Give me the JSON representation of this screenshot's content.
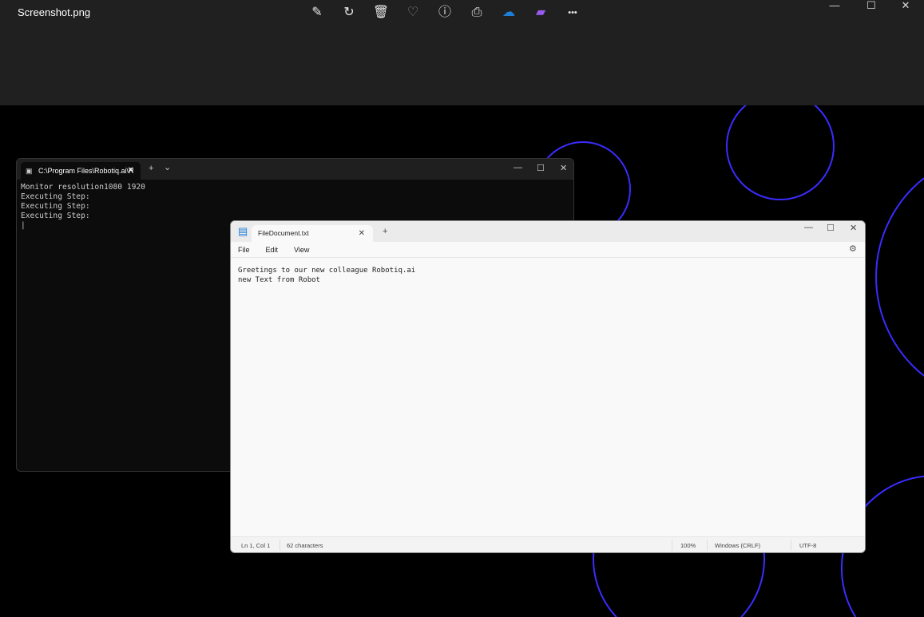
{
  "viewer": {
    "title": "Screenshot.png",
    "toolbar": [
      {
        "icon": "edit-image-icon",
        "glyph": "✎"
      },
      {
        "icon": "rotate-icon",
        "glyph": "↻"
      },
      {
        "icon": "delete-icon",
        "glyph": "🗑"
      },
      {
        "icon": "favorite-heart-icon",
        "glyph": "♡"
      },
      {
        "icon": "info-icon",
        "glyph": "ⓘ"
      },
      {
        "icon": "print-icon",
        "glyph": "⎙"
      },
      {
        "icon": "onedrive-off-icon",
        "glyph": "☁"
      },
      {
        "icon": "clipchamp-icon",
        "glyph": "▰"
      },
      {
        "icon": "more-icon",
        "glyph": "•••"
      }
    ],
    "window_controls": {
      "minimize": "—",
      "maximize": "☐",
      "close": "✕"
    }
  },
  "terminal": {
    "tab_title": "C:\\Program Files\\Robotiq.ai\\R",
    "new_tab": "+",
    "dropdown": "⌄",
    "lines": "Monitor resolution1080 1920\nExecuting Step:\nExecuting Step:\nExecuting Step:\n|"
  },
  "notepad": {
    "tab_title": "FileDocument.txt",
    "new_tab": "+",
    "menu": [
      "File",
      "Edit",
      "View"
    ],
    "content": "Greetings to our new colleague Robotiq.ai\nnew Text from Robot",
    "status": {
      "position": "Ln 1, Col 1",
      "characters": "62 characters",
      "zoom": "100%",
      "line_ending": "Windows (CRLF)",
      "encoding": "UTF-8"
    }
  },
  "colors": {
    "circle": "#3a2cff",
    "topbar": "#202020"
  }
}
